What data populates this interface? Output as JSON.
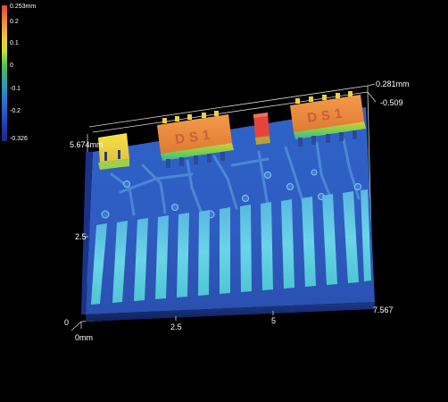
{
  "colorbar": {
    "labels": [
      "0.253mm",
      "0.2",
      "0.1",
      "0",
      "-0.1",
      "-0.2",
      "-0.326"
    ],
    "colors": [
      "#e8443a",
      "#f0c83a",
      "#52c24a",
      "#2aa6a8",
      "#2a6fd6",
      "#1a2a8a"
    ]
  },
  "axes": {
    "z_top_label": "0.281mm",
    "z_bottom_label": "-0.509",
    "y_top_label": "5.674mm",
    "y_mid_label": "2.5",
    "y_origin_label": "0",
    "x_origin_label": "0mm",
    "x_tick_1": "2.5",
    "x_tick_2": "5",
    "x_end_label": "7.567"
  },
  "components": {
    "left_chip_marking": "",
    "center_chip_marking": "DS1",
    "right_chip_marking": "DS1"
  }
}
